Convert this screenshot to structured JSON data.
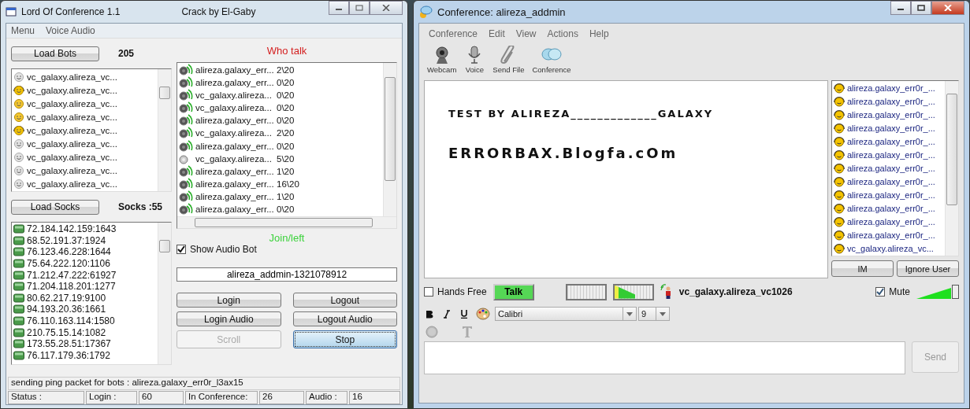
{
  "left_window": {
    "title": "Lord Of Conference 1.1",
    "subtitle": "Crack by El-Gaby",
    "menu": [
      "Menu",
      "Voice Audio"
    ],
    "load_bots": "Load Bots",
    "bot_count": "205",
    "bots": [
      {
        "name": "vc_galaxy.alireza_vc...",
        "kind": "idle"
      },
      {
        "name": "vc_galaxy.alireza_vc...",
        "kind": "voice"
      },
      {
        "name": "vc_galaxy.alireza_vc...",
        "kind": "online"
      },
      {
        "name": "vc_galaxy.alireza_vc...",
        "kind": "online"
      },
      {
        "name": "vc_galaxy.alireza_vc...",
        "kind": "voice"
      },
      {
        "name": "vc_galaxy.alireza_vc...",
        "kind": "idle"
      },
      {
        "name": "vc_galaxy.alireza_vc...",
        "kind": "idle"
      },
      {
        "name": "vc_galaxy.alireza_vc...",
        "kind": "idle"
      },
      {
        "name": "vc_galaxy.alireza_vc...",
        "kind": "idle"
      }
    ],
    "load_socks": "Load Socks",
    "socks_count": "Socks :55",
    "socks": [
      "72.184.142.159:1643",
      "68.52.191.37:1924",
      "76.123.46.228:1644",
      "75.64.222.120:1106",
      "71.212.47.222:61927",
      "71.204.118.201:1277",
      "80.62.217.19:9100",
      "94.193.20.36:1661",
      "76.110.163.114:1580",
      "210.75.15.14:1082",
      "173.55.28.51:17367",
      "76.117.179.36:1792"
    ],
    "who_talk_label": "Who talk",
    "talkers": [
      {
        "name": "alireza.galaxy_err...",
        "count": "2\\20",
        "on": true
      },
      {
        "name": "alireza.galaxy_err...",
        "count": "0\\20",
        "on": true
      },
      {
        "name": "vc_galaxy.alireza...",
        "count": "0\\20",
        "on": true
      },
      {
        "name": "vc_galaxy.alireza...",
        "count": "0\\20",
        "on": true
      },
      {
        "name": "alireza.galaxy_err...",
        "count": "0\\20",
        "on": true
      },
      {
        "name": "vc_galaxy.alireza...",
        "count": "2\\20",
        "on": true
      },
      {
        "name": "alireza.galaxy_err...",
        "count": "0\\20",
        "on": true
      },
      {
        "name": "vc_galaxy.alireza...",
        "count": "5\\20",
        "on": false
      },
      {
        "name": "alireza.galaxy_err...",
        "count": "1\\20",
        "on": true
      },
      {
        "name": "alireza.galaxy_err...",
        "count": "16\\20",
        "on": true
      },
      {
        "name": "alireza.galaxy_err...",
        "count": "1\\20",
        "on": true
      },
      {
        "name": "alireza.galaxy_err...",
        "count": "0\\20",
        "on": true
      }
    ],
    "join_left_label": "Join/left",
    "show_audio_bot": {
      "label": "Show Audio Bot",
      "checked": true
    },
    "room_field": {
      "value": "alireza_addmin-1321078912"
    },
    "buttons": [
      {
        "label": "Login",
        "disabled": false,
        "selected": false
      },
      {
        "label": "Logout",
        "disabled": false,
        "selected": false
      },
      {
        "label": "Login Audio",
        "disabled": false,
        "selected": false
      },
      {
        "label": "Logout Audio",
        "disabled": false,
        "selected": false
      },
      {
        "label": "Scroll",
        "disabled": true,
        "selected": false
      },
      {
        "label": "Stop",
        "disabled": false,
        "selected": true
      }
    ],
    "status_line": "sending ping packet for bots : alireza.galaxy_err0r_l3ax15",
    "status_bar": [
      "Status :",
      "Login :",
      "60",
      "In Conference:",
      "26",
      "Audio :",
      "16"
    ]
  },
  "right_window": {
    "title": "Conference:  alireza_addmin",
    "menu": [
      "Conference",
      "Edit",
      "View",
      "Actions",
      "Help"
    ],
    "toolbar": [
      {
        "label": "Webcam",
        "kind": "webcam"
      },
      {
        "label": "Voice",
        "kind": "voice"
      },
      {
        "label": "Send File",
        "kind": "file"
      },
      {
        "label": "Conference",
        "kind": "conference"
      }
    ],
    "messages": [
      "TEST BY ALIREZA_____________GALAXY",
      "ERRORBAX.Blogfa.cOm"
    ],
    "users": [
      "alireza.galaxy_err0r_...",
      "alireza.galaxy_err0r_...",
      "alireza.galaxy_err0r_...",
      "alireza.galaxy_err0r_...",
      "alireza.galaxy_err0r_...",
      "alireza.galaxy_err0r_...",
      "alireza.galaxy_err0r_...",
      "alireza.galaxy_err0r_...",
      "alireza.galaxy_err0r_...",
      "alireza.galaxy_err0r_...",
      "alireza.galaxy_err0r_...",
      "alireza.galaxy_err0r_...",
      "vc_galaxy.alireza_vc..."
    ],
    "im_button": "IM",
    "ignore_button": "Ignore User",
    "hands_free": {
      "label": "Hands Free",
      "checked": false
    },
    "talk_button": "Talk",
    "meters": [
      {
        "level": 0
      },
      {
        "level": 0.55
      }
    ],
    "speaker": "vc_galaxy.alireza_vc1026",
    "mute": {
      "label": "Mute",
      "checked": true
    },
    "volume": {
      "level": 1
    },
    "font": "Calibri",
    "size": "9",
    "send_button": "Send"
  }
}
